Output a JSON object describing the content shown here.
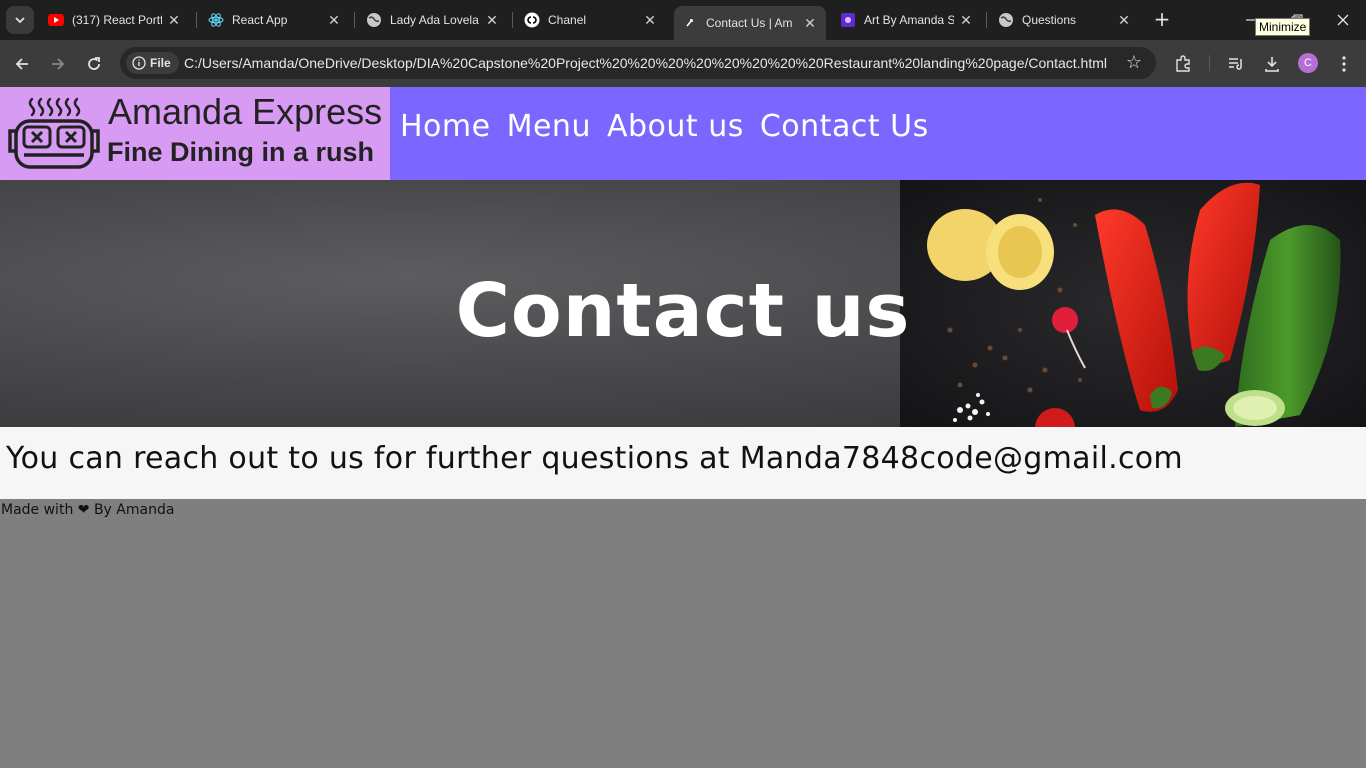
{
  "browser": {
    "tabs": [
      {
        "title": "(317) React Portf",
        "icon": "youtube-icon"
      },
      {
        "title": "React App",
        "icon": "react-icon"
      },
      {
        "title": "Lady Ada Lovela",
        "icon": "globe-icon"
      },
      {
        "title": "Chanel",
        "icon": "chanel-icon"
      },
      {
        "title": "Contact Us | Am",
        "icon": "page-icon",
        "active": true
      },
      {
        "title": "Art By Amanda S",
        "icon": "art-icon"
      },
      {
        "title": "Questions",
        "icon": "globe-icon"
      }
    ],
    "tooltip": "Minimize",
    "address": {
      "scheme_label": "File",
      "url": "C:/Users/Amanda/OneDrive/Desktop/DIA%20Capstone%20Project%20%20%20%20%20%20%20%20Restaurant%20landing%20page/Contact.html"
    },
    "profile_initial": "C"
  },
  "site": {
    "brand_name": "Amanda Express",
    "tagline": "Fine Dining in a rush",
    "nav": [
      "Home",
      "Menu",
      "About us",
      "Contact Us"
    ],
    "hero_title": "Contact us",
    "contact_message": "You can reach out to us for further questions at Manda7848code@gmail.com",
    "footer": {
      "prefix": "Made with",
      "heart": "❤",
      "suffix": "By Amanda"
    }
  },
  "colors": {
    "brand_bg": "#d89bf4",
    "header_bg": "#7b66ff",
    "page_bg": "#7f7f7f",
    "band_bg": "#f6f6f6"
  }
}
